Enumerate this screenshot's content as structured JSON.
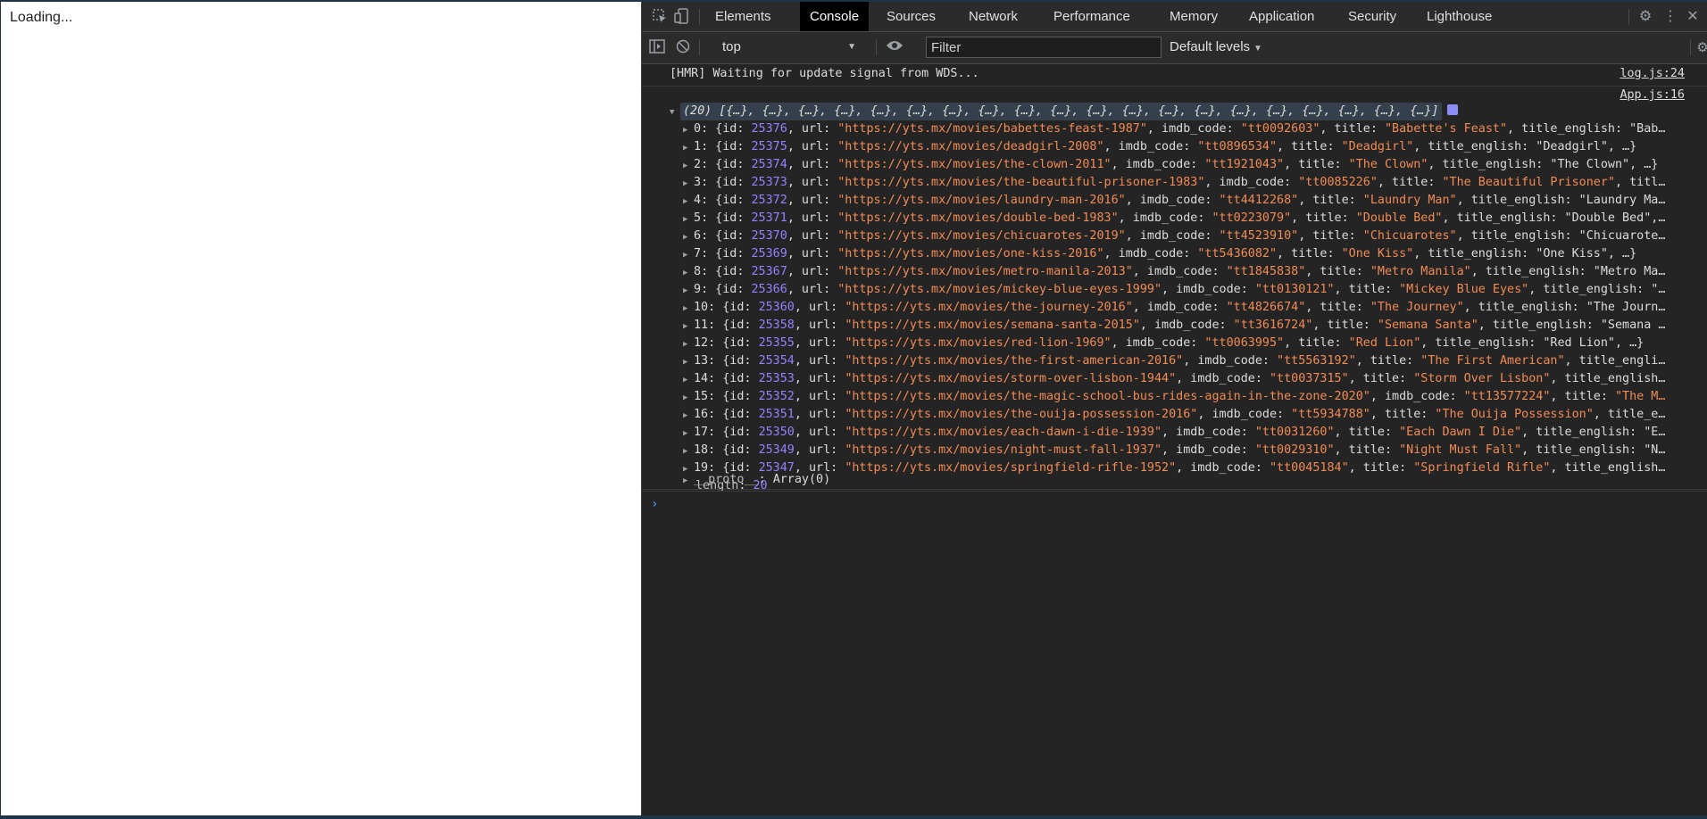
{
  "page": {
    "loading_text": "Loading..."
  },
  "devtools": {
    "tabs": [
      "Elements",
      "Console",
      "Sources",
      "Network",
      "Performance",
      "Memory",
      "Application",
      "Security",
      "Lighthouse"
    ],
    "active_tab": "Console",
    "toolbar": {
      "context": "top",
      "filter_placeholder": "Filter",
      "levels": "Default levels"
    }
  },
  "console": {
    "hmr_message": "[HMR] Waiting for update signal from WDS...",
    "hmr_source": "log.js:24",
    "array_source": "App.js:16",
    "array_summary": "(20) [{…}, {…}, {…}, {…}, {…}, {…}, {…}, {…}, {…}, {…}, {…}, {…}, {…}, {…}, {…}, {…}, {…}, {…}, {…}, {…}]",
    "rows": [
      {
        "i": "0",
        "id": "25376",
        "url": "\"https://yts.mx/movies/babettes-feast-1987\"",
        "imdb": "\"tt0092603\"",
        "title": "\"Babette's Feast\"",
        "tail": "title_english: \"Bab…"
      },
      {
        "i": "1",
        "id": "25375",
        "url": "\"https://yts.mx/movies/deadgirl-2008\"",
        "imdb": "\"tt0896534\"",
        "title": "\"Deadgirl\"",
        "tail": "title_english: \"Deadgirl\", …}"
      },
      {
        "i": "2",
        "id": "25374",
        "url": "\"https://yts.mx/movies/the-clown-2011\"",
        "imdb": "\"tt1921043\"",
        "title": "\"The Clown\"",
        "tail": "title_english: \"The Clown\", …}"
      },
      {
        "i": "3",
        "id": "25373",
        "url": "\"https://yts.mx/movies/the-beautiful-prisoner-1983\"",
        "imdb": "\"tt0085226\"",
        "title": "\"The Beautiful Prisoner\"",
        "tail": "titl…"
      },
      {
        "i": "4",
        "id": "25372",
        "url": "\"https://yts.mx/movies/laundry-man-2016\"",
        "imdb": "\"tt4412268\"",
        "title": "\"Laundry Man\"",
        "tail": "title_english: \"Laundry Ma…"
      },
      {
        "i": "5",
        "id": "25371",
        "url": "\"https://yts.mx/movies/double-bed-1983\"",
        "imdb": "\"tt0223079\"",
        "title": "\"Double Bed\"",
        "tail": "title_english: \"Double Bed\",…"
      },
      {
        "i": "6",
        "id": "25370",
        "url": "\"https://yts.mx/movies/chicuarotes-2019\"",
        "imdb": "\"tt4523910\"",
        "title": "\"Chicuarotes\"",
        "tail": "title_english: \"Chicuarote…"
      },
      {
        "i": "7",
        "id": "25369",
        "url": "\"https://yts.mx/movies/one-kiss-2016\"",
        "imdb": "\"tt5436082\"",
        "title": "\"One Kiss\"",
        "tail": "title_english: \"One Kiss\", …}"
      },
      {
        "i": "8",
        "id": "25367",
        "url": "\"https://yts.mx/movies/metro-manila-2013\"",
        "imdb": "\"tt1845838\"",
        "title": "\"Metro Manila\"",
        "tail": "title_english: \"Metro Ma…"
      },
      {
        "i": "9",
        "id": "25366",
        "url": "\"https://yts.mx/movies/mickey-blue-eyes-1999\"",
        "imdb": "\"tt0130121\"",
        "title": "\"Mickey Blue Eyes\"",
        "tail": "title_english: \"…"
      },
      {
        "i": "10",
        "id": "25360",
        "url": "\"https://yts.mx/movies/the-journey-2016\"",
        "imdb": "\"tt4826674\"",
        "title": "\"The Journey\"",
        "tail": "title_english: \"The Journ…"
      },
      {
        "i": "11",
        "id": "25358",
        "url": "\"https://yts.mx/movies/semana-santa-2015\"",
        "imdb": "\"tt3616724\"",
        "title": "\"Semana Santa\"",
        "tail": "title_english: \"Semana …"
      },
      {
        "i": "12",
        "id": "25355",
        "url": "\"https://yts.mx/movies/red-lion-1969\"",
        "imdb": "\"tt0063995\"",
        "title": "\"Red Lion\"",
        "tail": "title_english: \"Red Lion\", …}"
      },
      {
        "i": "13",
        "id": "25354",
        "url": "\"https://yts.mx/movies/the-first-american-2016\"",
        "imdb": "\"tt5563192\"",
        "title": "\"The First American\"",
        "tail": "title_engli…"
      },
      {
        "i": "14",
        "id": "25353",
        "url": "\"https://yts.mx/movies/storm-over-lisbon-1944\"",
        "imdb": "\"tt0037315\"",
        "title": "\"Storm Over Lisbon\"",
        "tail": "title_english…"
      },
      {
        "i": "15",
        "id": "25352",
        "url": "\"https://yts.mx/movies/the-magic-school-bus-rides-again-in-the-zone-2020\"",
        "imdb": "\"tt13577224\"",
        "title": "\"The M…",
        "tail": ""
      },
      {
        "i": "16",
        "id": "25351",
        "url": "\"https://yts.mx/movies/the-ouija-possession-2016\"",
        "imdb": "\"tt5934788\"",
        "title": "\"The Ouija Possession\"",
        "tail": "title_e…"
      },
      {
        "i": "17",
        "id": "25350",
        "url": "\"https://yts.mx/movies/each-dawn-i-die-1939\"",
        "imdb": "\"tt0031260\"",
        "title": "\"Each Dawn I Die\"",
        "tail": "title_english: \"E…"
      },
      {
        "i": "18",
        "id": "25349",
        "url": "\"https://yts.mx/movies/night-must-fall-1937\"",
        "imdb": "\"tt0029310\"",
        "title": "\"Night Must Fall\"",
        "tail": "title_english: \"N…"
      },
      {
        "i": "19",
        "id": "25347",
        "url": "\"https://yts.mx/movies/springfield-rifle-1952\"",
        "imdb": "\"tt0045184\"",
        "title": "\"Springfield Rifle\"",
        "tail": "title_english…"
      }
    ],
    "length_label": "length",
    "length_value": "20",
    "proto_label": "__proto__",
    "proto_value": "Array(0)"
  },
  "icons": {
    "inspect": "inspect-icon",
    "device": "device-toggle-icon",
    "settings": "gear-icon",
    "menu": "kebab-menu-icon",
    "close": "close-icon",
    "sidebar": "sidebar-icon",
    "clear": "clear-console-icon",
    "eye": "eye-icon"
  },
  "colors": {
    "number": "#9980ff",
    "string": "#f28b54",
    "prompt": "#4e9cff"
  }
}
